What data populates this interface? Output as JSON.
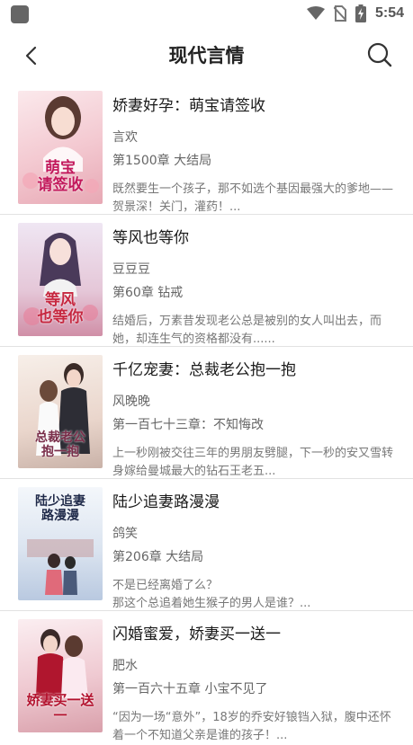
{
  "status_bar": {
    "time": "5:54",
    "icons": [
      "app-icon",
      "wifi-icon",
      "no-sim-icon",
      "battery-charging-icon"
    ]
  },
  "header": {
    "title": "现代言情",
    "back_icon": "back-arrow-icon",
    "search_icon": "search-icon"
  },
  "books": [
    {
      "title": "娇妻好孕：萌宝请签收",
      "author": "言欢",
      "chapter": "第1500章 大结局",
      "description": "既然要生一个孩子，那不如选个基因最强大的爹地——贺景深！关门，灌药！...",
      "cover_text": "萌宝\n请签收",
      "cover_colors": [
        "#f6d7dc",
        "#e7a8b4"
      ]
    },
    {
      "title": "等风也等你",
      "author": "豆豆豆",
      "chapter": "第60章 钻戒",
      "description": "结婚后，万素昔发现老公总是被别的女人叫出去，而她，却连生气的资格都没有......",
      "cover_text": "等风\n也等你",
      "cover_colors": [
        "#e9e0ef",
        "#d08fa7"
      ]
    },
    {
      "title": "千亿宠妻：总裁老公抱一抱",
      "author": "风晚晚",
      "chapter": "第一百七十三章：不知悔改",
      "description": "上一秒刚被交往三年的男朋友劈腿，下一秒的安又雪转身嫁给曼城最大的钻石王老五...",
      "cover_text": "总裁老公\n抱一抱",
      "cover_colors": [
        "#f3e6e0",
        "#c9b2a8"
      ]
    },
    {
      "title": "陆少追妻路漫漫",
      "author": "鸽笑",
      "chapter": "第206章 大结局",
      "description": "不是已经离婚了么？\n    那这个总追着她生猴子的男人是谁？...",
      "cover_text": "陆少追妻\n路漫漫",
      "cover_colors": [
        "#e6eef7",
        "#b9c9e0"
      ]
    },
    {
      "title": "闪婚蜜爱，娇妻买一送一",
      "author": "肥水",
      "chapter": "第一百六十五章 小宝不见了",
      "description": "“因为一场“意外”，18岁的乔安好锒铛入狱，腹中还怀着一个不知道父亲是谁的孩子！...",
      "cover_text": "娇妻买一送一",
      "cover_colors": [
        "#f6e1e5",
        "#d9a0ab"
      ]
    }
  ]
}
